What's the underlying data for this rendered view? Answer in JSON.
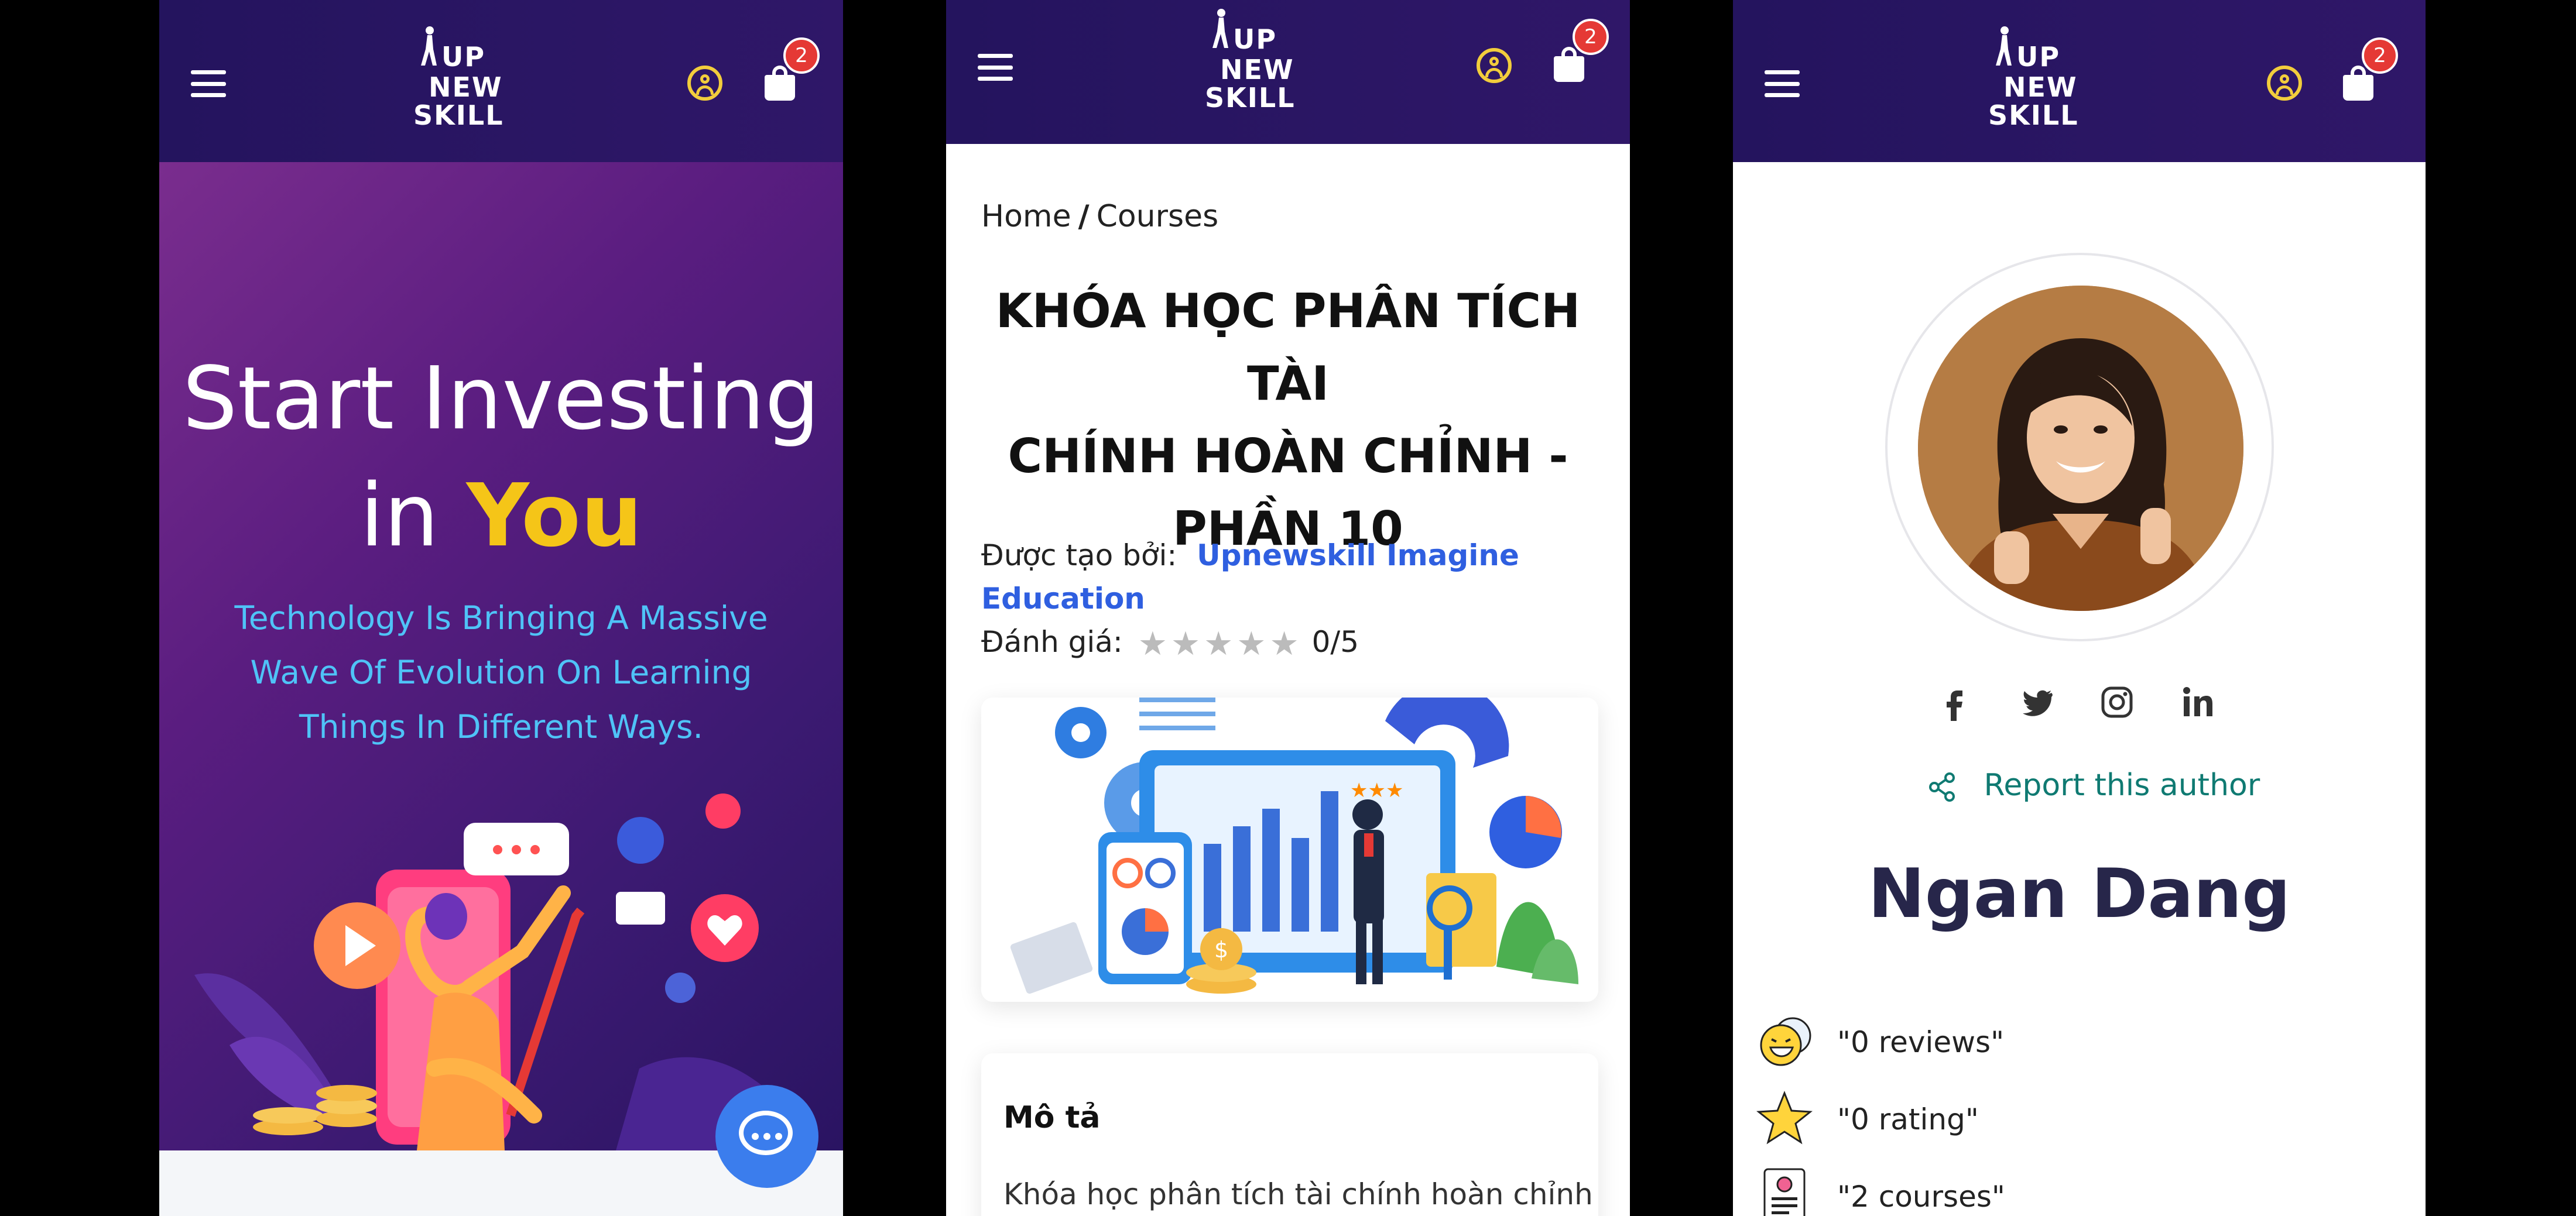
{
  "header": {
    "logo": {
      "line1": "UP",
      "line2": "NEW",
      "line3": "SKILL"
    },
    "cart_count": "2"
  },
  "home": {
    "hero_title_line1": "Start Investing",
    "hero_title_in": "in",
    "hero_title_you": "You",
    "hero_subtitle_line1": "Technology Is Bringing A Massive",
    "hero_subtitle_line2": "Wave Of Evolution On Learning",
    "hero_subtitle_line3": "Things In Different Ways."
  },
  "course": {
    "breadcrumb_home": "Home",
    "breadcrumb_sep": "/",
    "breadcrumb_current": "Courses",
    "title_line1": "KHÓA HỌC PHÂN TÍCH TÀI",
    "title_line2": "CHÍNH HOÀN CHỈNH -",
    "title_line3": "PHẦN 10",
    "created_by_label": "Được tạo bởi:",
    "creator_line1": "Upnewskill Imagine",
    "creator_line2": "Education",
    "rating_label": "Đánh giá:",
    "rating_value": "0/5",
    "rating_stars_filled": 0,
    "rating_stars_total": 5,
    "description_title": "Mô tả",
    "description_text": "Khóa học phân tích tài chính hoàn chỉnh -"
  },
  "author": {
    "name": "Ngan Dang",
    "report_label": "Report this author",
    "stats": [
      {
        "icon": "laughing-face-icon",
        "label": "\"0 reviews\""
      },
      {
        "icon": "star-icon",
        "label": "\"0 rating\""
      },
      {
        "icon": "certificate-icon",
        "label": "\"2 courses\""
      }
    ],
    "social": [
      "facebook-icon",
      "twitter-icon",
      "instagram-icon",
      "linkedin-icon"
    ]
  },
  "colors": {
    "header_bg": "#2a1665",
    "accent_yellow": "#f5c518",
    "accent_cyan": "#4fc3f7",
    "link_blue": "#2f5fe0",
    "report_teal": "#0f7a72",
    "badge_red": "#e53935",
    "chat_blue": "#3b7ded"
  }
}
